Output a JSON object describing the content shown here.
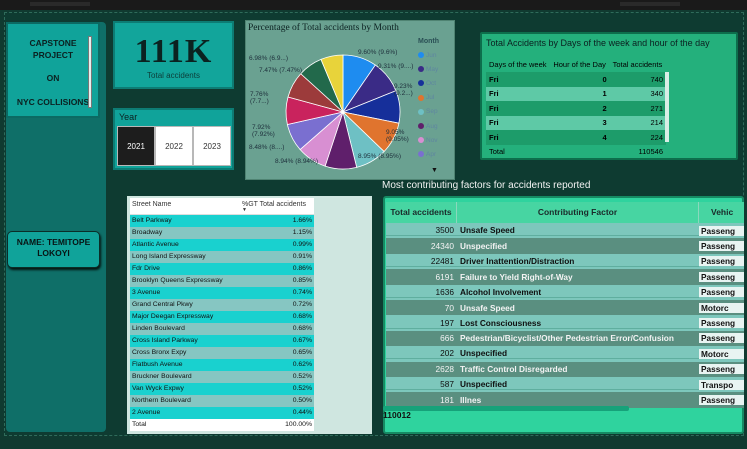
{
  "title_card": {
    "line1": "CAPSTONE",
    "line2": "PROJECT",
    "line3": "ON",
    "line4": "NYC  COLLISIONS"
  },
  "name_card": {
    "line1": "NAME: TEMITOPE",
    "line2": "LOKOYI"
  },
  "kpi": {
    "value": "111K",
    "label": "Total accidents"
  },
  "year_slicer": {
    "label": "Year",
    "options": [
      "2021",
      "2022",
      "2023"
    ],
    "selected": "2021"
  },
  "pie": {
    "title": "Percentage of Total accidents by Month",
    "legend_title": "Month",
    "legend": [
      "Jun",
      "May",
      "Oct",
      "Jul",
      "Sep",
      "Aug",
      "Nov",
      "Apr"
    ],
    "labels": [
      "9.60% (9.6%)",
      "9.31% (9....)",
      "9.23% (9.2...)",
      "9.05% (9.05%)",
      "8.95% (8.95%)",
      "8.94% (8.94%)",
      "8.48% (8....)",
      "7.92% (7.92%)",
      "7.76% (7.7...)",
      "7.47% (7.47%)",
      "6.98% (6.9...)"
    ],
    "colors": [
      "#1e8cf0",
      "#3a2b86",
      "#162f9a",
      "#e0742e",
      "#6ec0c4",
      "#5f1f6b",
      "#d88fd2",
      "#7a6fd0",
      "#c9235d",
      "#9c3b3b",
      "#22694b",
      "#e8d33a"
    ]
  },
  "chart_data": {
    "type": "pie",
    "title": "Percentage of Total accidents by Month",
    "legend_title": "Month",
    "slices": [
      {
        "label": "Jun",
        "value": 9.6,
        "color": "#1e8cf0"
      },
      {
        "label": "May",
        "value": 9.31,
        "color": "#3a2b86"
      },
      {
        "label": "Oct",
        "value": 9.23,
        "color": "#162f9a"
      },
      {
        "label": "Jul",
        "value": 9.05,
        "color": "#e0742e"
      },
      {
        "label": "Sep",
        "value": 8.95,
        "color": "#6ec0c4"
      },
      {
        "label": "Aug",
        "value": 8.94,
        "color": "#5f1f6b"
      },
      {
        "label": "Nov",
        "value": 8.48,
        "color": "#d88fd2"
      },
      {
        "label": "Apr",
        "value": 7.92,
        "color": "#7a6fd0"
      },
      {
        "label": "",
        "value": 7.76,
        "color": "#c9235d"
      },
      {
        "label": "",
        "value": 7.47,
        "color": "#9c3b3b"
      },
      {
        "label": "",
        "value": 6.98,
        "color": "#22694b"
      },
      {
        "label": "",
        "value": 6.31,
        "color": "#e8d33a"
      }
    ]
  },
  "days_table": {
    "title": "Total Accidents by Days of the week and hour of the day",
    "columns": [
      "Days of the week",
      "Hour of the Day",
      "Total accidents"
    ],
    "rows": [
      [
        "Fri",
        "0",
        "740"
      ],
      [
        "Fri",
        "1",
        "340"
      ],
      [
        "Fri",
        "2",
        "271"
      ],
      [
        "Fri",
        "3",
        "214"
      ],
      [
        "Fri",
        "4",
        "224"
      ]
    ],
    "total_label": "Total",
    "total_value": "110546"
  },
  "street_table": {
    "columns": [
      "Street Name",
      "%GT Total accidents"
    ],
    "rows": [
      [
        "Belt Parkway",
        "1.66%"
      ],
      [
        "Broadway",
        "1.15%"
      ],
      [
        "Atlantic Avenue",
        "0.99%"
      ],
      [
        "Long Island Expressway",
        "0.91%"
      ],
      [
        "Fdr Drive",
        "0.86%"
      ],
      [
        "Brooklyn Queens Expressway",
        "0.85%"
      ],
      [
        "3 Avenue",
        "0.74%"
      ],
      [
        "Grand Central Pkwy",
        "0.72%"
      ],
      [
        "Major Deegan Expressway",
        "0.68%"
      ],
      [
        "Linden Boulevard",
        "0.68%"
      ],
      [
        "Cross Island Parkway",
        "0.67%"
      ],
      [
        "Cross Bronx Expy",
        "0.65%"
      ],
      [
        "Flatbush Avenue",
        "0.62%"
      ],
      [
        "Bruckner Boulevard",
        "0.52%"
      ],
      [
        "Van Wyck Expwy",
        "0.52%"
      ],
      [
        "Northern Boulevard",
        "0.50%"
      ],
      [
        "2 Avenue",
        "0.44%"
      ]
    ],
    "total_label": "Total",
    "total_value": "100.00%"
  },
  "factors_table": {
    "title": "Most contributing factors for accidents reported",
    "columns": [
      "Total accidents",
      "Contributing Factor",
      "Vehic"
    ],
    "rows": [
      [
        "3500",
        "Unsafe Speed",
        "Passeng"
      ],
      [
        "24340",
        "Unspecified",
        "Passeng"
      ],
      [
        "22481",
        "Driver Inattention/Distraction",
        "Passeng"
      ],
      [
        "6191",
        "Failure to Yield Right-of-Way",
        "Passeng"
      ],
      [
        "1636",
        "Alcohol Involvement",
        "Passeng"
      ],
      [
        "70",
        "Unsafe Speed",
        "Motorc"
      ],
      [
        "197",
        "Lost Consciousness",
        "Passeng"
      ],
      [
        "666",
        "Pedestrian/Bicyclist/Other Pedestrian Error/Confusion",
        "Passeng"
      ],
      [
        "202",
        "Unspecified",
        "Motorc"
      ],
      [
        "2628",
        "Traffic Control Disregarded",
        "Passeng"
      ],
      [
        "587",
        "Unspecified",
        "Transpo"
      ],
      [
        "181",
        "Illnes",
        "Passeng"
      ]
    ],
    "total_value": "110012"
  }
}
